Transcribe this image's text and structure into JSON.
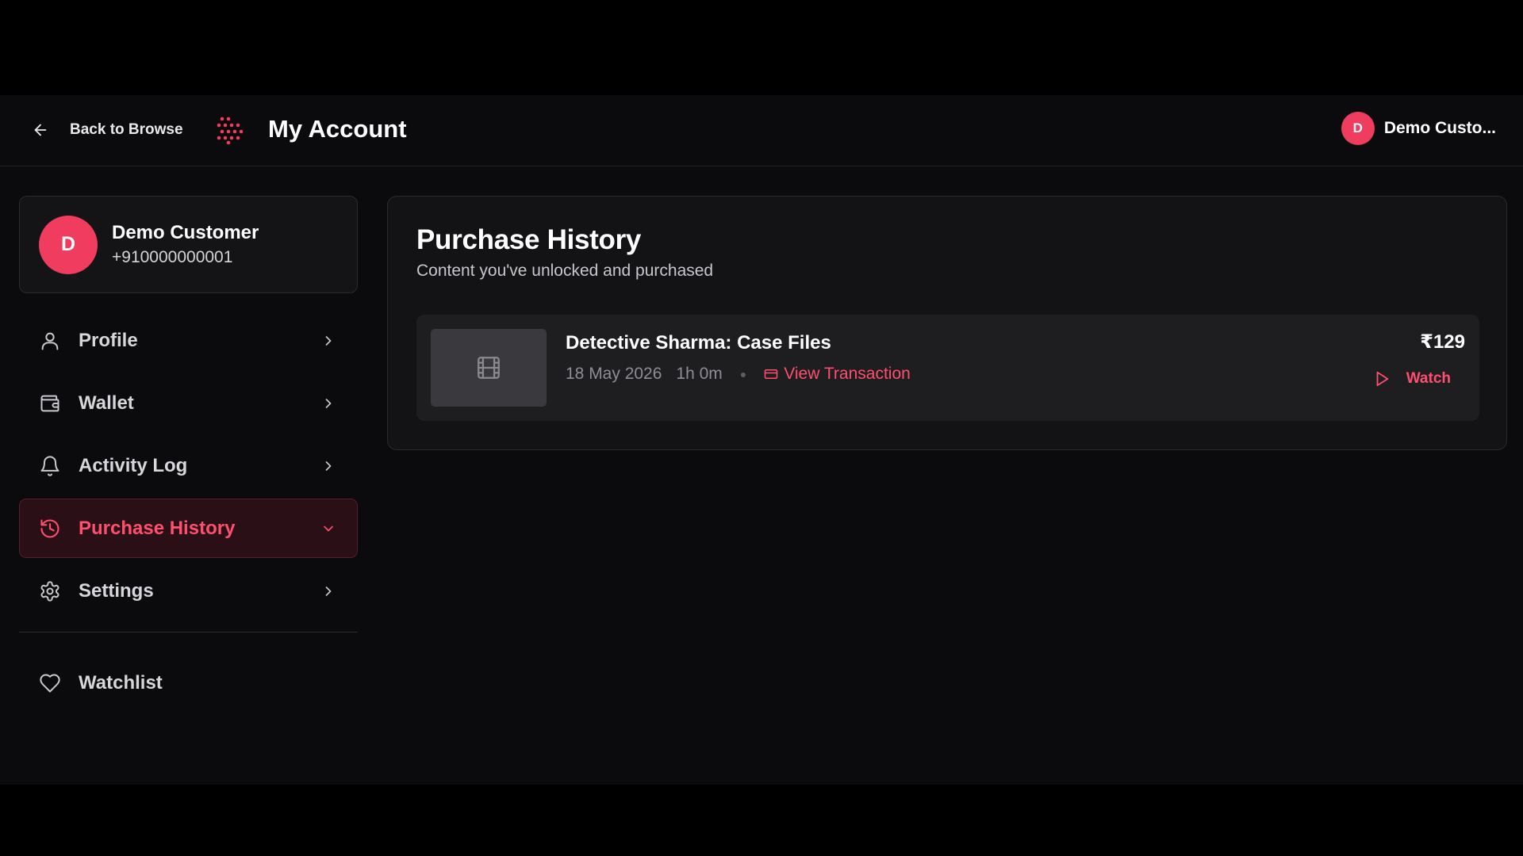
{
  "header": {
    "back_label": "Back to Browse",
    "title": "My Account",
    "user_initial": "D",
    "user_name": "Demo Custo..."
  },
  "profile": {
    "initial": "D",
    "name": "Demo Customer",
    "phone": "+910000000001"
  },
  "sidebar": {
    "items": [
      {
        "label": "Profile",
        "icon": "user-icon"
      },
      {
        "label": "Wallet",
        "icon": "wallet-icon"
      },
      {
        "label": "Activity Log",
        "icon": "bell-icon"
      },
      {
        "label": "Purchase History",
        "icon": "history-icon",
        "active": true
      },
      {
        "label": "Settings",
        "icon": "gear-icon"
      }
    ],
    "watchlist_label": "Watchlist"
  },
  "main": {
    "title": "Purchase History",
    "subtitle": "Content you've unlocked and purchased",
    "purchases": [
      {
        "title": "Detective Sharma: Case Files",
        "date": "18 May 2026",
        "duration": "1h 0m",
        "transaction_label": "View Transaction",
        "price": "₹129",
        "watch_label": "Watch"
      }
    ]
  },
  "colors": {
    "accent": "#f03c5e",
    "accent_text": "#ff4f6e",
    "background": "#0b0b0d",
    "panel": "#131316"
  }
}
